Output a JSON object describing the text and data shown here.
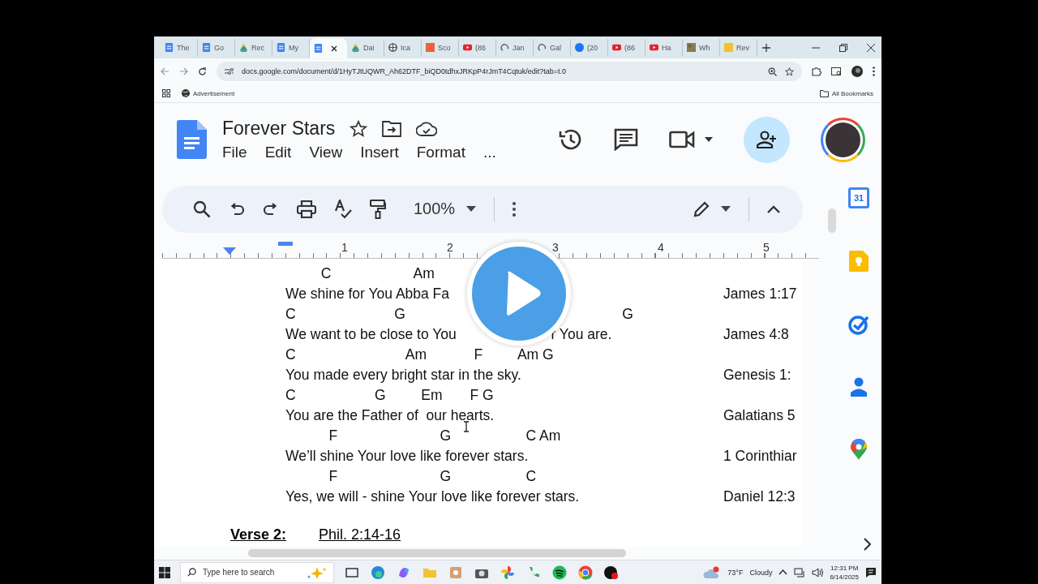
{
  "browser": {
    "tabs": [
      {
        "title": "The",
        "kind": "doc",
        "selected": false
      },
      {
        "title": "Go",
        "kind": "doc",
        "selected": false
      },
      {
        "title": "Rec",
        "kind": "drive",
        "selected": false
      },
      {
        "title": "My",
        "kind": "doc",
        "selected": false
      },
      {
        "kind": "doc",
        "selected": true
      },
      {
        "title": "Dai",
        "kind": "drive",
        "selected": false
      },
      {
        "title": "Ica",
        "kind": "globe",
        "selected": false
      },
      {
        "title": "Sco",
        "kind": "sc",
        "selected": false
      },
      {
        "title": "(86",
        "kind": "yt",
        "selected": false
      },
      {
        "title": "Jan",
        "kind": "arc",
        "selected": false
      },
      {
        "title": "Gal",
        "kind": "arc",
        "selected": false
      },
      {
        "title": "(20",
        "kind": "fb",
        "selected": false
      },
      {
        "title": "(86",
        "kind": "yt",
        "selected": false
      },
      {
        "title": "Ha",
        "kind": "yt",
        "selected": false
      },
      {
        "title": "Wh",
        "kind": "img",
        "selected": false
      },
      {
        "title": "Rev",
        "kind": "sq",
        "selected": false
      }
    ],
    "address": "docs.google.com/document/d/1HyTJtUQWR_Ah62DTF_biQD0tdhxJRKpP4rJmT4Cqtuk/edit?tab=t.0",
    "bookmarks": [
      "Advertisement"
    ],
    "all_bookmarks": "All Bookmarks"
  },
  "doc": {
    "title": "Forever Stars",
    "menu": [
      "File",
      "Edit",
      "View",
      "Insert",
      "Format",
      "..."
    ],
    "zoom": "100%",
    "ruler_numbers": [
      "1",
      "2",
      "3",
      "4",
      "5"
    ]
  },
  "stanza": [
    {
      "chords": "         C                     Am",
      "lyric": "We shine for You Abba Fa",
      "ref": "James 1:17"
    },
    {
      "chords": "C                         G                                                       G",
      "lyric": "We want to be close to You                        r You are.",
      "ref": "James 4:8"
    },
    {
      "chords": "C                            Am            F         Am G",
      "lyric": "You made every bright star in the sky.",
      "ref": "Genesis 1:"
    },
    {
      "chords": "C                    G         Em       F G",
      "lyric": "You are the Father of  our hearts.",
      "ref": "Galatians 5"
    },
    {
      "chords": "           F                          G                   C Am",
      "lyric": "We’ll shine Your love like forever stars.",
      "ref": "1 Corinthiar"
    },
    {
      "chords": "           F                          G                   C",
      "lyric": "Yes, we will - shine Your love like forever stars.",
      "ref": "Daniel 12:3"
    }
  ],
  "verse": {
    "label": "Verse 2:",
    "ref": "Phil. 2:14-16"
  },
  "sidebar": {
    "calendar_day": "31"
  },
  "taskbar": {
    "search_placeholder": "Type here to search",
    "temperature": "73°F",
    "weather": "Cloudy",
    "time": "12:31 PM",
    "date": "6/14/2025"
  }
}
